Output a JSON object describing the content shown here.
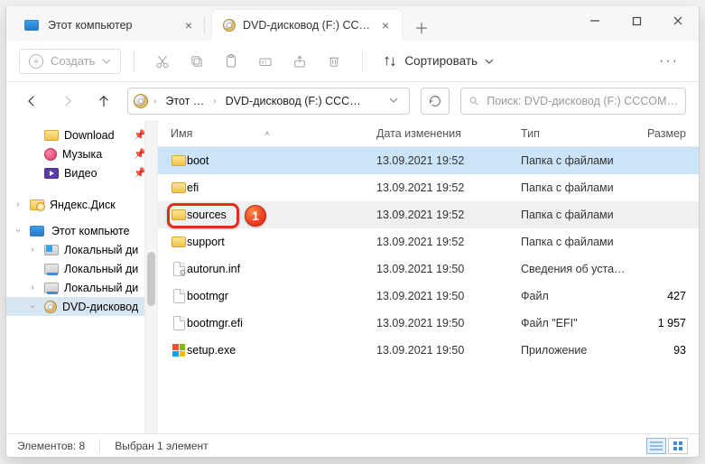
{
  "tabs": {
    "inactive_title": "Этот компьютер",
    "active_title": "DVD-дисковод (F:) CCCOMA_"
  },
  "commandbar": {
    "create": "Создать",
    "sort": "Сортировать"
  },
  "breadcrumbs": {
    "b1": "Этот …",
    "b2": "DVD-дисковод (F:) CCC…"
  },
  "search_placeholder": "Поиск: DVD-дисковод (F:) CCCOM…",
  "nav": {
    "download": "Download",
    "music": "Музыка",
    "video": "Видео",
    "yadisk": "Яндекс.Диск",
    "thispc": "Этот компьюте",
    "ld1": "Локальный ди",
    "ld2": "Локальный ди",
    "ld3": "Локальный ди",
    "dvd": "DVD-дисковод"
  },
  "columns": {
    "name": "Имя",
    "date": "Дата изменения",
    "type": "Тип",
    "size": "Размер"
  },
  "rows": [
    {
      "name": "boot",
      "date": "13.09.2021 19:52",
      "type": "Папка с файлами",
      "size": "",
      "kind": "folder",
      "state": "selected"
    },
    {
      "name": "efi",
      "date": "13.09.2021 19:52",
      "type": "Папка с файлами",
      "size": "",
      "kind": "folder",
      "state": ""
    },
    {
      "name": "sources",
      "date": "13.09.2021 19:52",
      "type": "Папка с файлами",
      "size": "",
      "kind": "folder",
      "state": "hover"
    },
    {
      "name": "support",
      "date": "13.09.2021 19:52",
      "type": "Папка с файлами",
      "size": "",
      "kind": "folder",
      "state": ""
    },
    {
      "name": "autorun.inf",
      "date": "13.09.2021 19:50",
      "type": "Сведения об уста…",
      "size": "",
      "kind": "inf",
      "state": ""
    },
    {
      "name": "bootmgr",
      "date": "13.09.2021 19:50",
      "type": "Файл",
      "size": "427",
      "kind": "file",
      "state": ""
    },
    {
      "name": "bootmgr.efi",
      "date": "13.09.2021 19:50",
      "type": "Файл \"EFI\"",
      "size": "1 957",
      "kind": "file",
      "state": ""
    },
    {
      "name": "setup.exe",
      "date": "13.09.2021 19:50",
      "type": "Приложение",
      "size": "93",
      "kind": "exe",
      "state": ""
    }
  ],
  "status": {
    "count": "Элементов: 8",
    "selected": "Выбран 1 элемент"
  },
  "callout_badge": "1"
}
